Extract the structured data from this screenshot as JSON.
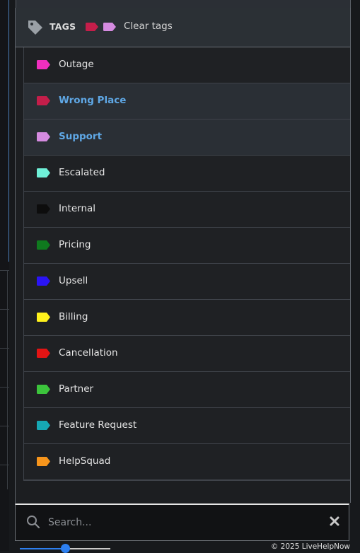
{
  "header": {
    "title": "TAGS",
    "selected_chip_colors": [
      "#c41e4a",
      "#d58be0"
    ],
    "clear_label": "Clear tags",
    "icon": "tag-icon"
  },
  "tags": [
    {
      "label": "Outage",
      "color": "#f02fbf",
      "selected": false
    },
    {
      "label": "Wrong Place",
      "color": "#c41e4a",
      "selected": true
    },
    {
      "label": "Support",
      "color": "#d58be0",
      "selected": true
    },
    {
      "label": "Escalated",
      "color": "#6ff0d8",
      "selected": false
    },
    {
      "label": "Internal",
      "color": "#0d0d0d",
      "selected": false
    },
    {
      "label": "Pricing",
      "color": "#0f7a1e",
      "selected": false
    },
    {
      "label": "Upsell",
      "color": "#2a14f5",
      "selected": false
    },
    {
      "label": "Billing",
      "color": "#fff21c",
      "selected": false
    },
    {
      "label": "Cancellation",
      "color": "#e31414",
      "selected": false
    },
    {
      "label": "Partner",
      "color": "#3cc43c",
      "selected": false
    },
    {
      "label": "Feature Request",
      "color": "#16a8b4",
      "selected": false
    },
    {
      "label": "HelpSquad",
      "color": "#f7951c",
      "selected": false
    }
  ],
  "search": {
    "placeholder": "Search...",
    "value": "",
    "icon": "search-icon",
    "clear_icon": "close-icon"
  },
  "slider": {
    "value": 0.5
  },
  "footer": {
    "text": "© 2025 LiveHelpNow"
  },
  "colors": {
    "accent": "#5fa8e6",
    "slider": "#2d7ff0"
  }
}
